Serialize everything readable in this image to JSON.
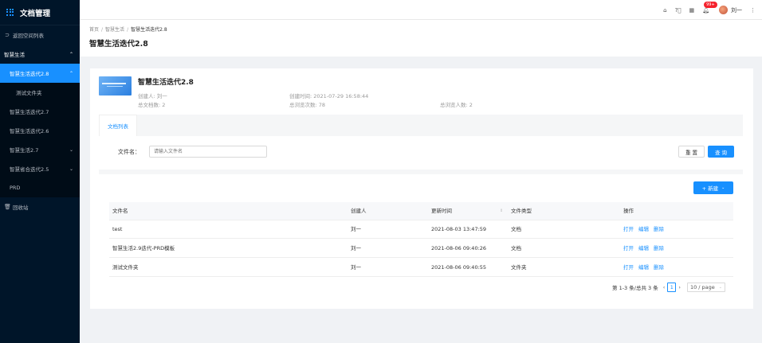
{
  "app": {
    "title": "文档管理"
  },
  "sidebar": {
    "back": "返回空间列表",
    "group": "智慧生活",
    "items": [
      {
        "label": "智慧生活迭代2.8",
        "active": true
      },
      {
        "label": "测试文件夹"
      },
      {
        "label": "智慧生活迭代2.7"
      },
      {
        "label": "智慧生活迭代2.6"
      },
      {
        "label": "智慧生活2.7"
      },
      {
        "label": "智慧省合迭代2.5"
      },
      {
        "label": "PRD"
      }
    ],
    "recycle": "回收站"
  },
  "header": {
    "badge": "99+",
    "user": "刘一"
  },
  "breadcrumb": {
    "home": "首页",
    "space": "智慧生活",
    "current": "智慧生活迭代2.8"
  },
  "page_title": "智慧生活迭代2.8",
  "info": {
    "title": "智慧生活迭代2.8",
    "creator": "创建人: 刘一",
    "created_time": "创建时间: 2021-07-29 16:58:44",
    "doc_count": "总文档数: 2",
    "views": "总浏览次数: 78",
    "viewers": "总浏览人数: 2"
  },
  "tabs": {
    "doc_list": "文档列表"
  },
  "filter": {
    "label": "文件名：",
    "placeholder": "请输入文件名",
    "reset": "重 置",
    "query": "查 询"
  },
  "new_button": "+ 新建",
  "table": {
    "headers": [
      "文件名",
      "创建人",
      "更新时间",
      "文件类型",
      "操作"
    ],
    "rows": [
      {
        "name": "test",
        "creator": "刘一",
        "updated": "2021-08-03 13:47:59",
        "type": "文档"
      },
      {
        "name": "智慧生活2.9迭代-PRD模板",
        "creator": "刘一",
        "updated": "2021-08-06 09:40:26",
        "type": "文档"
      },
      {
        "name": "测试文件夹",
        "creator": "刘一",
        "updated": "2021-08-06 09:40:55",
        "type": "文件夹"
      }
    ],
    "actions": {
      "open": "打开",
      "edit": "编辑",
      "delete": "删除"
    }
  },
  "pagination": {
    "summary": "第 1-3 条/总共 3 条",
    "page": "1",
    "page_size": "10 / page"
  },
  "colors": {
    "primary": "#1890ff",
    "sidebar_bg": "#001529",
    "badge": "#f5222d"
  }
}
